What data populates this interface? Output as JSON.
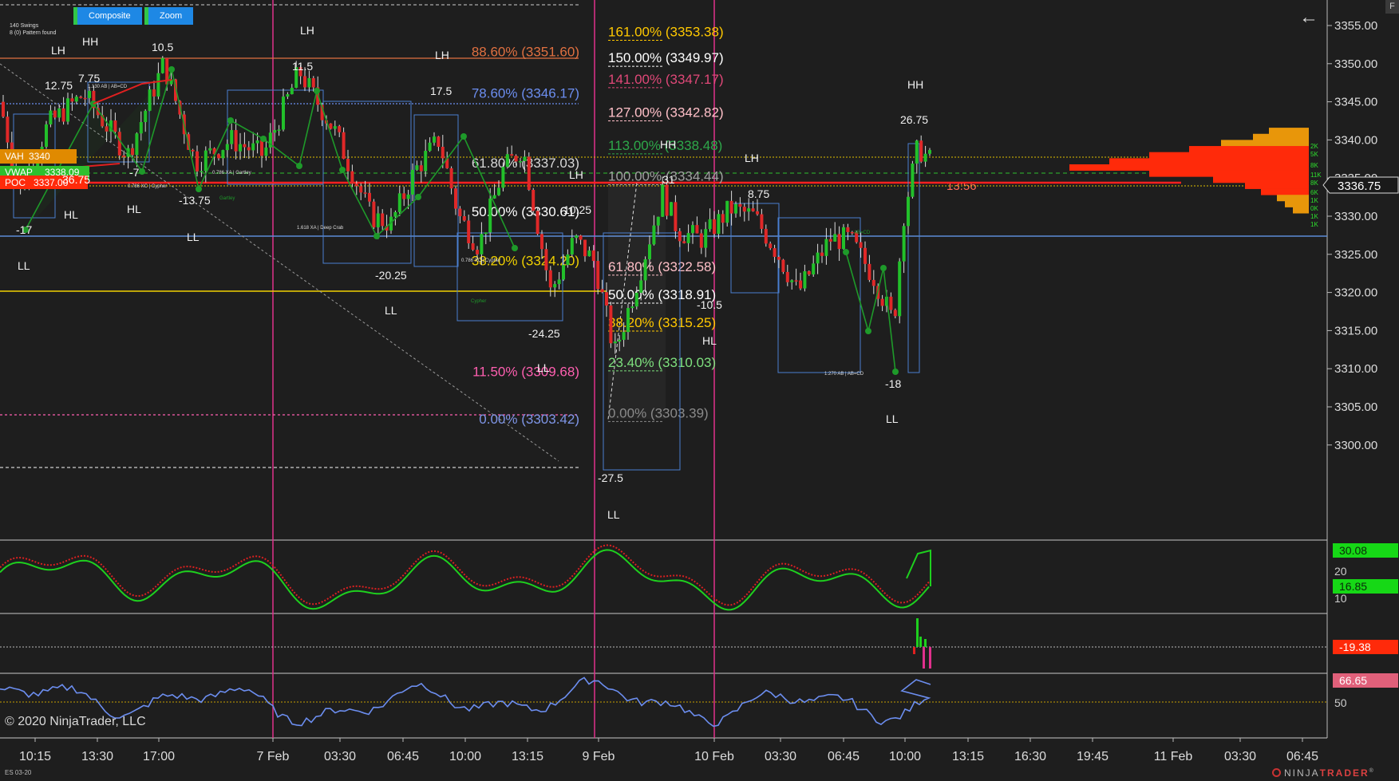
{
  "toolbar": {
    "composite_label": "Composite",
    "zoom_label": "Zoom"
  },
  "info": {
    "swings": "140 Swings",
    "patterns": "8 (0) Pattern found"
  },
  "corner_label": "F",
  "copyright": "© 2020 NinjaTrader, LLC",
  "symbol": "ES 03-20",
  "brand": {
    "prefix": "NINJA",
    "suffix": "TRADER",
    "mark": "®"
  },
  "price_axis": {
    "ticks": [
      "3355.00",
      "3350.00",
      "3345.00",
      "3340.00",
      "3335.00",
      "3330.00",
      "3325.00",
      "3320.00",
      "3315.00",
      "3310.00",
      "3305.00",
      "3300.00"
    ],
    "current_price": "3336.75",
    "time_to_bar": "13:56"
  },
  "time_axis": {
    "labels": [
      "10:15",
      "13:30",
      "17:00",
      "7 Feb",
      "03:30",
      "06:45",
      "10:00",
      "13:15",
      "9 Feb",
      "10 Feb",
      "03:30",
      "06:45",
      "10:00",
      "13:15",
      "16:30",
      "19:45",
      "11 Feb",
      "03:30",
      "06:45"
    ]
  },
  "left_fib": [
    {
      "label": "88.60% (3351.60)",
      "color": "#e07040"
    },
    {
      "label": "78.60% (3346.17)",
      "color": "#6c8ef0"
    },
    {
      "label": "61.80% (3337.03)",
      "color": "#d8d8d8"
    },
    {
      "label": "50.00% (3330.61)",
      "color": "#ffffff"
    },
    {
      "label": "38.20% (3324.20)",
      "color": "#f0d000"
    },
    {
      "label": "11.50% (3309.68)",
      "color": "#ff5fb0"
    },
    {
      "label": "0.00% (3303.42)",
      "color": "#7f96e8"
    }
  ],
  "right_fib": [
    {
      "label": "161.00% (3353.38)",
      "color": "#ffc800"
    },
    {
      "label": "150.00% (3349.97)",
      "color": "#ffffff"
    },
    {
      "label": "141.00% (3347.17)",
      "color": "#e04878"
    },
    {
      "label": "127.00% (3342.82)",
      "color": "#ffc0c8"
    },
    {
      "label": "113.00% (3338.48)",
      "color": "#2ea84a"
    },
    {
      "label": "100.00% (3334.44)",
      "color": "#a0a0a0"
    },
    {
      "label": "61.80% (3322.58)",
      "color": "#ffc0c8"
    },
    {
      "label": "50.00% (3318.91)",
      "color": "#ffffff"
    },
    {
      "label": "38.20% (3315.25)",
      "color": "#ffc800"
    },
    {
      "label": "23.40% (3310.03)",
      "color": "#7ee07e"
    },
    {
      "label": "0.00% (3303.39)",
      "color": "#8a8a8a"
    }
  ],
  "swing_labels": [
    {
      "t": "HH"
    },
    {
      "t": "LH"
    },
    {
      "t": "10.5"
    },
    {
      "t": "LH"
    },
    {
      "t": "7.75"
    },
    {
      "t": "12.75"
    },
    {
      "t": "11.5"
    },
    {
      "t": "17.5"
    },
    {
      "t": "LH"
    },
    {
      "t": "HL"
    },
    {
      "t": "HL"
    },
    {
      "t": "-17"
    },
    {
      "t": "-7"
    },
    {
      "t": "-13.75"
    },
    {
      "t": "LL"
    },
    {
      "t": "LL"
    },
    {
      "t": "-20.25"
    },
    {
      "t": "LL"
    },
    {
      "t": "-24.25"
    },
    {
      "t": "LL"
    },
    {
      "t": "10.25"
    },
    {
      "t": "HH"
    },
    {
      "t": "LH"
    },
    {
      "t": "31"
    },
    {
      "t": "8.75"
    },
    {
      "t": "-10.5"
    },
    {
      "t": "HL"
    },
    {
      "t": "-27.5"
    },
    {
      "t": "LL"
    },
    {
      "t": "HH"
    },
    {
      "t": "26.75"
    },
    {
      "t": "-18"
    },
    {
      "t": "LL"
    },
    {
      "t": "LH"
    }
  ],
  "pattern_labels": [
    "1.130 AB | AB=CD",
    "0.786 XA | Gartley",
    "0.786 XC | Cypher",
    "1.618 XA | Deep Crab",
    "0.786 XC | Cypher",
    "1.270 AB | AB=CD",
    "AB=CD",
    "Cypher",
    "Gartley"
  ],
  "volume_profile": {
    "markers": [
      "VAH",
      "VWAP",
      "POC"
    ],
    "left_values": [
      "3340",
      "3338.09",
      "3337.00",
      "36.75"
    ],
    "scale_labels": [
      "2K",
      "5K",
      "8K",
      "11K",
      "8K",
      "6K",
      "1K",
      "0K",
      "1K",
      "1K"
    ]
  },
  "stochastic_panel": {
    "value_green": "30.08",
    "value_green2": "16.85",
    "tick_20": "20",
    "tick_10": "10"
  },
  "momentum_panel": {
    "value": "-19.38"
  },
  "rsi_panel": {
    "value": "66.65",
    "tick_50": "50"
  },
  "colors": {
    "background": "#1e1e1e",
    "up_candle": "#22c02a",
    "down_candle": "#e02828",
    "session_line": "#e0308c",
    "green_badge": "#16d816",
    "red_badge": "#ff2a0a",
    "pink_badge": "#e0607a"
  }
}
